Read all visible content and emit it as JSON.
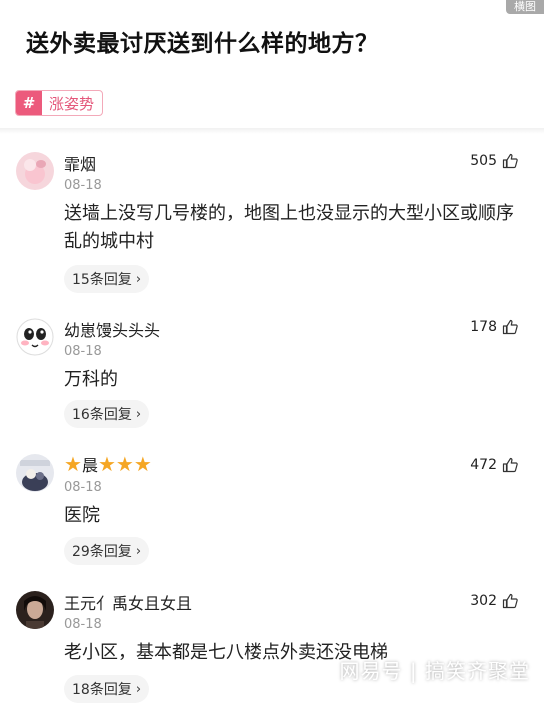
{
  "corner_tag": "横图",
  "title": "送外卖最讨厌送到什么样的地方？",
  "topic": {
    "label": "涨姿势",
    "hash": "#"
  },
  "comments": [
    {
      "name": "霏烟",
      "date": "08-18",
      "likes": "505",
      "text": "送墙上没写几号楼的，地图上也没显示的大型小区或顺序乱的城中村",
      "replies": "15条回复"
    },
    {
      "name": "幼崽馒头头头",
      "date": "08-18",
      "likes": "178",
      "text": "万科的",
      "replies": "16条回复"
    },
    {
      "name_star": "★",
      "name": "晨",
      "name_stars_after": "★★★",
      "date": "08-18",
      "likes": "472",
      "text": "医院",
      "replies": "29条回复"
    },
    {
      "name": "王元亻禹女且女且",
      "date": "08-18",
      "likes": "302",
      "text": "老小区，基本都是七八楼点外卖还没电梯",
      "replies": "18条回复"
    }
  ],
  "watermark": "网易号 | 搞笑齐聚堂",
  "icons": {
    "like": "thumbs-up-icon",
    "chevron": "chevron-right-icon"
  }
}
